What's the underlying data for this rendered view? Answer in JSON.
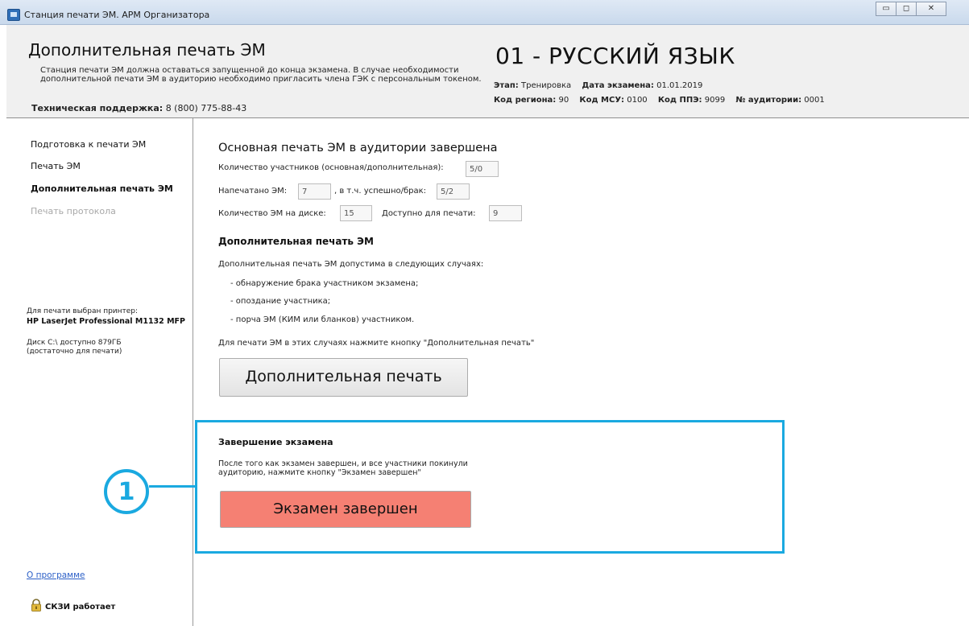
{
  "window": {
    "title": "Станция печати ЭМ. АРМ Организатора",
    "controls": [
      "minimize-icon",
      "maximize-icon",
      "close-icon"
    ]
  },
  "header": {
    "title": "Дополнительная печать ЭМ",
    "description": "Станция печати ЭМ должна оставаться запущенной до конца экзамена. В случае необходимости дополнительной печати ЭМ в аудиторию необходимо пригласить члена ГЭК с персональным токеном.",
    "support_label": "Техническая поддержка:",
    "support_phone": "8 (800) 775-88-43",
    "subject": "01 - РУССКИЙ ЯЗЫК",
    "stage_label": "Этап:",
    "stage_value": "Тренировка",
    "date_label": "Дата экзамена:",
    "date_value": "01.01.2019",
    "region_label": "Код региона:",
    "region_value": "90",
    "msu_label": "Код МСУ:",
    "msu_value": "0100",
    "ppe_label": "Код ППЭ:",
    "ppe_value": "9099",
    "room_label": "№ аудитории:",
    "room_value": "0001"
  },
  "sidebar": {
    "items": [
      {
        "label": "Подготовка к печати ЭМ",
        "state": "normal"
      },
      {
        "label": "Печать ЭМ",
        "state": "normal"
      },
      {
        "label": "Дополнительная печать ЭМ",
        "state": "active"
      },
      {
        "label": "Печать протокола",
        "state": "disabled"
      }
    ],
    "printer_label": "Для печати выбран принтер:",
    "printer_name": "HP LaserJet Professional M1132 MFP",
    "disk_line1": "Диск C:\\ доступно 879ГБ",
    "disk_line2": "(достаточно для печати)",
    "about_link": "О программе",
    "skzi_status": "СКЗИ работает"
  },
  "main": {
    "section_title": "Основная печать ЭМ в аудитории завершена",
    "participants_label": "Количество участников (основная/дополнительная):",
    "participants_value": "5/0",
    "printed_label": "Напечатано ЭМ:",
    "printed_value": "7",
    "success_label": ", в т.ч. успешно/брак:",
    "success_value": "5/2",
    "disk_count_label": "Количество ЭМ на диске:",
    "disk_count_value": "15",
    "available_label": "Доступно для печати:",
    "available_value": "9",
    "extra_title": "Дополнительная печать ЭМ",
    "extra_intro": "Дополнительная печать ЭМ допустима в следующих случаях:",
    "extra_cases": [
      "- обнаружение брака участником экзамена;",
      "- опоздание участника;",
      "- порча ЭМ (КИМ или бланков) участником."
    ],
    "extra_hint": "Для печати ЭМ в этих случаях нажмите кнопку \"Дополнительная печать\"",
    "extra_button": "Дополнительная печать",
    "finish_title": "Завершение экзамена",
    "finish_text_line1": "После того как экзамен завершен, и все участники покинули",
    "finish_text_line2": "аудиторию, нажмите кнопку \"Экзамен завершен\"",
    "finish_button": "Экзамен завершен"
  },
  "annotation": {
    "callout_number": "1",
    "accent_color": "#1aa9e0"
  },
  "colors": {
    "finish_button": "#f58073",
    "highlight_border": "#1aa9e0",
    "link": "#2b5fc7"
  }
}
